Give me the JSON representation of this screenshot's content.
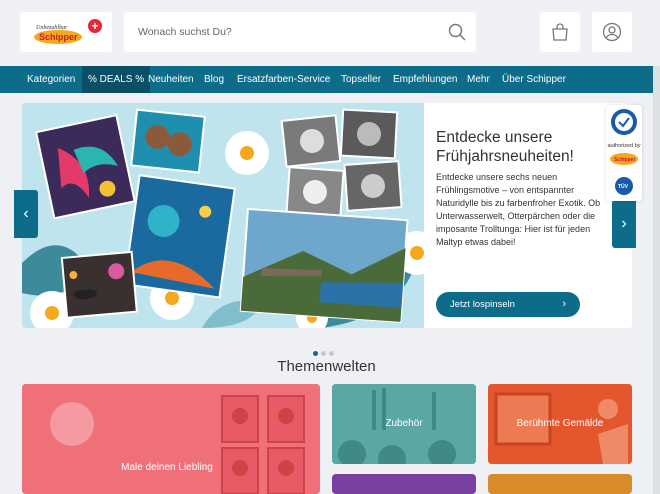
{
  "header": {
    "logo_alt": "Schipper",
    "search_placeholder": "Wonach suchst Du?",
    "cart_icon": "shopping-bag-icon",
    "account_icon": "user-icon"
  },
  "nav": {
    "items": [
      {
        "label": "Kategorien"
      },
      {
        "label": "% DEALS %"
      },
      {
        "label": "Neuheiten"
      },
      {
        "label": "Blog"
      },
      {
        "label": "Ersatzfarben-Service"
      },
      {
        "label": "Topseller"
      },
      {
        "label": "Empfehlungen"
      },
      {
        "label": "Mehr"
      },
      {
        "label": "Über Schipper"
      }
    ]
  },
  "hero": {
    "title": "Entdecke unsere Frühjahrsneuheiten!",
    "description": "Entdecke unsere sechs neuen Frühlingsmotive – von entspannter Naturidylle bis zu farbenfroher Exotik. Ob Unterwasserwelt, Otterpärchen oder die imposante Trolltunga: Hier ist für jeden Maltyp etwas dabei!",
    "cta_label": "Jetzt lospinseln",
    "prev_label": "‹",
    "next_label": "›"
  },
  "badge": {
    "auth_text": "authorized by"
  },
  "themes": {
    "title": "Themenwelten",
    "tiles": [
      {
        "label": "Male deinen Liebling"
      },
      {
        "label": "Zubehör"
      },
      {
        "label": "Berühmte Gemälde"
      }
    ]
  },
  "colors": {
    "primary": "#0d6c8a",
    "deals_bg": "#0a4f66",
    "tile_pink": "#f0707a",
    "tile_teal": "#5aa7a3",
    "tile_orange": "#e4572e"
  }
}
